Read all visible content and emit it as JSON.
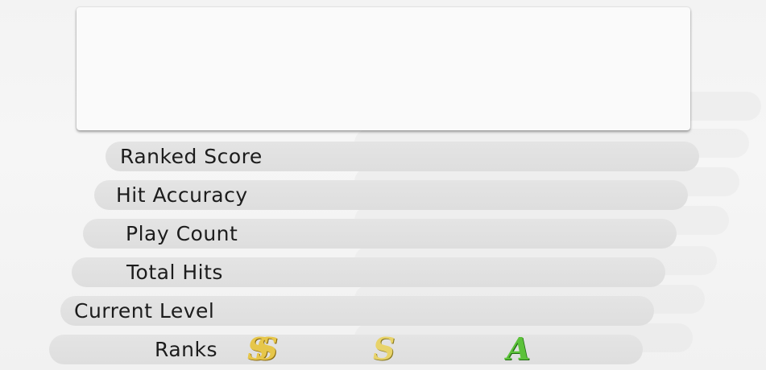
{
  "stats": {
    "ranked_score_label": "Ranked Score",
    "hit_accuracy_label": "Hit Accuracy",
    "play_count_label": "Play Count",
    "total_hits_label": "Total Hits",
    "current_level_label": "Current Level",
    "ranks_label": "Ranks"
  },
  "ranks": {
    "icons": [
      {
        "name": "rank-ss-icon",
        "glyph": "SS",
        "color": "#e6c64a"
      },
      {
        "name": "rank-s-icon",
        "glyph": "S",
        "color": "#e8d36a"
      },
      {
        "name": "rank-a-icon",
        "glyph": "A",
        "color": "#5cc23a"
      }
    ]
  }
}
